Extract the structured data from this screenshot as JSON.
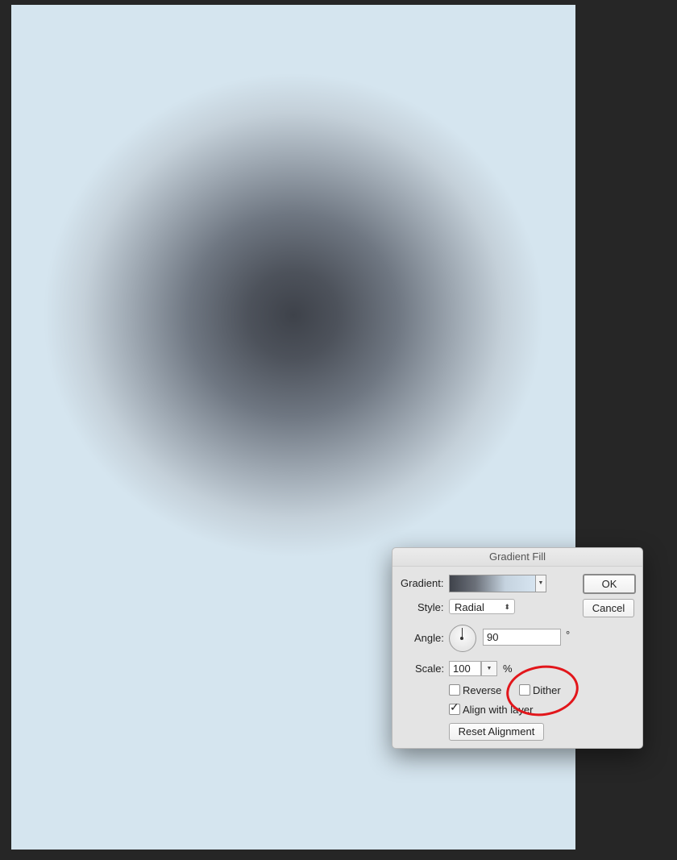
{
  "dialog": {
    "title": "Gradient Fill",
    "gradient_label": "Gradient:",
    "style_label": "Style:",
    "style_value": "Radial",
    "angle_label": "Angle:",
    "angle_value": "90",
    "angle_unit": "°",
    "scale_label": "Scale:",
    "scale_value": "100",
    "scale_unit": "%",
    "reverse_label": "Reverse",
    "reverse_checked": false,
    "dither_label": "Dither",
    "dither_checked": false,
    "align_label": "Align with layer",
    "align_checked": true,
    "reset_label": "Reset Alignment",
    "ok_label": "OK",
    "cancel_label": "Cancel",
    "checkmark": "✓",
    "dropdown_arrow": "▼",
    "updown_arrow": "⬍"
  },
  "annotation": {
    "highlight_color": "#e2161b",
    "highlights": "Dither"
  }
}
